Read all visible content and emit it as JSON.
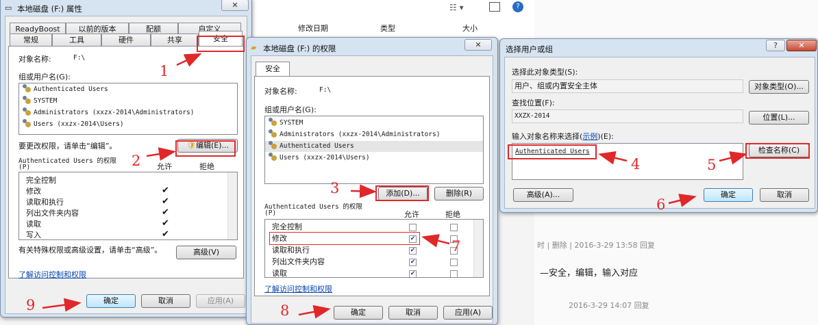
{
  "background": {
    "explorer_columns": [
      "修改日期",
      "类型",
      "大小"
    ],
    "forum": {
      "reply_line_1": "时 | 删除 | 2016-3-29 13:58 回复",
      "comment_text": "—安全，编辑，输入对应",
      "reply_line_2": "2016-3-29 14:07 回复"
    }
  },
  "props_window": {
    "title": "本地磁盘 (F:) 属性",
    "close": "✕",
    "tabs_row1": [
      "ReadyBoost",
      "以前的版本",
      "配额",
      "自定义"
    ],
    "tabs_row2": [
      "常规",
      "工具",
      "硬件",
      "共享",
      "安全"
    ],
    "object_label": "对象名称:",
    "object_value": "F:\\",
    "group_label": "组或用户名(G):",
    "users": [
      "Authenticated Users",
      "SYSTEM",
      "Administrators (xxzx-2014\\Administrators)",
      "Users (xxzx-2014\\Users)"
    ],
    "edit_hint": "要更改权限，请单击“编辑”。",
    "edit_button": "编辑(E)...",
    "perm_label": "Authenticated Users 的权限",
    "perm_label2": "(P)",
    "allow": "允许",
    "deny": "拒绝",
    "perms": [
      "完全控制",
      "修改",
      "读取和执行",
      "列出文件夹内容",
      "读取",
      "写入"
    ],
    "perm_allow_checked": [
      false,
      true,
      true,
      true,
      true,
      true
    ],
    "special_hint": "有关特殊权限或高级设置，请单击“高级”。",
    "advanced_button": "高级(V)",
    "learn_link": "了解访问控制和权限",
    "ok": "确定",
    "cancel": "取消",
    "apply": "应用(A)"
  },
  "perm_window": {
    "title": "本地磁盘 (F:) 的权限",
    "close": "✕",
    "tab": "安全",
    "object_label": "对象名称:",
    "object_value": "F:\\",
    "group_label": "组或用户名(G):",
    "users": [
      "SYSTEM",
      "Administrators (xxzx-2014\\Administrators)",
      "Authenticated Users",
      "Users (xxzx-2014\\Users)"
    ],
    "add_button": "添加(D)...",
    "remove_button": "删除(R)",
    "perm_label": "Authenticated Users 的权限",
    "perm_label2": "(P)",
    "allow": "允许",
    "deny": "拒绝",
    "perms": [
      "完全控制",
      "修改",
      "读取和执行",
      "列出文件夹内容",
      "读取"
    ],
    "perm_allow_checked": [
      false,
      true,
      true,
      true,
      true
    ],
    "learn_link": "了解访问控制和权限",
    "ok": "确定",
    "cancel": "取消",
    "apply": "应用(A)"
  },
  "select_window": {
    "title": "选择用户或组",
    "help": "?",
    "close": "✕",
    "type_label": "选择此对象类型(S):",
    "type_value": "用户、组或内置安全主体",
    "type_button": "对象类型(O)...",
    "location_label": "查找位置(F):",
    "location_value": "XXZX-2014",
    "location_button": "位置(L)...",
    "enter_label_pre": "输入对象名称来选择(",
    "enter_label_link": "示例",
    "enter_label_post": ")(E):",
    "entered_name": "Authenticated Users",
    "check_button": "检查名称(C)",
    "advanced_button": "高级(A)...",
    "ok": "确定",
    "cancel": "取消"
  },
  "annotations": [
    "1",
    "2",
    "3",
    "4",
    "5",
    "6",
    "7",
    "8",
    "9"
  ],
  "colors": {
    "annotation": "#e0282a",
    "link": "#0645ad"
  }
}
